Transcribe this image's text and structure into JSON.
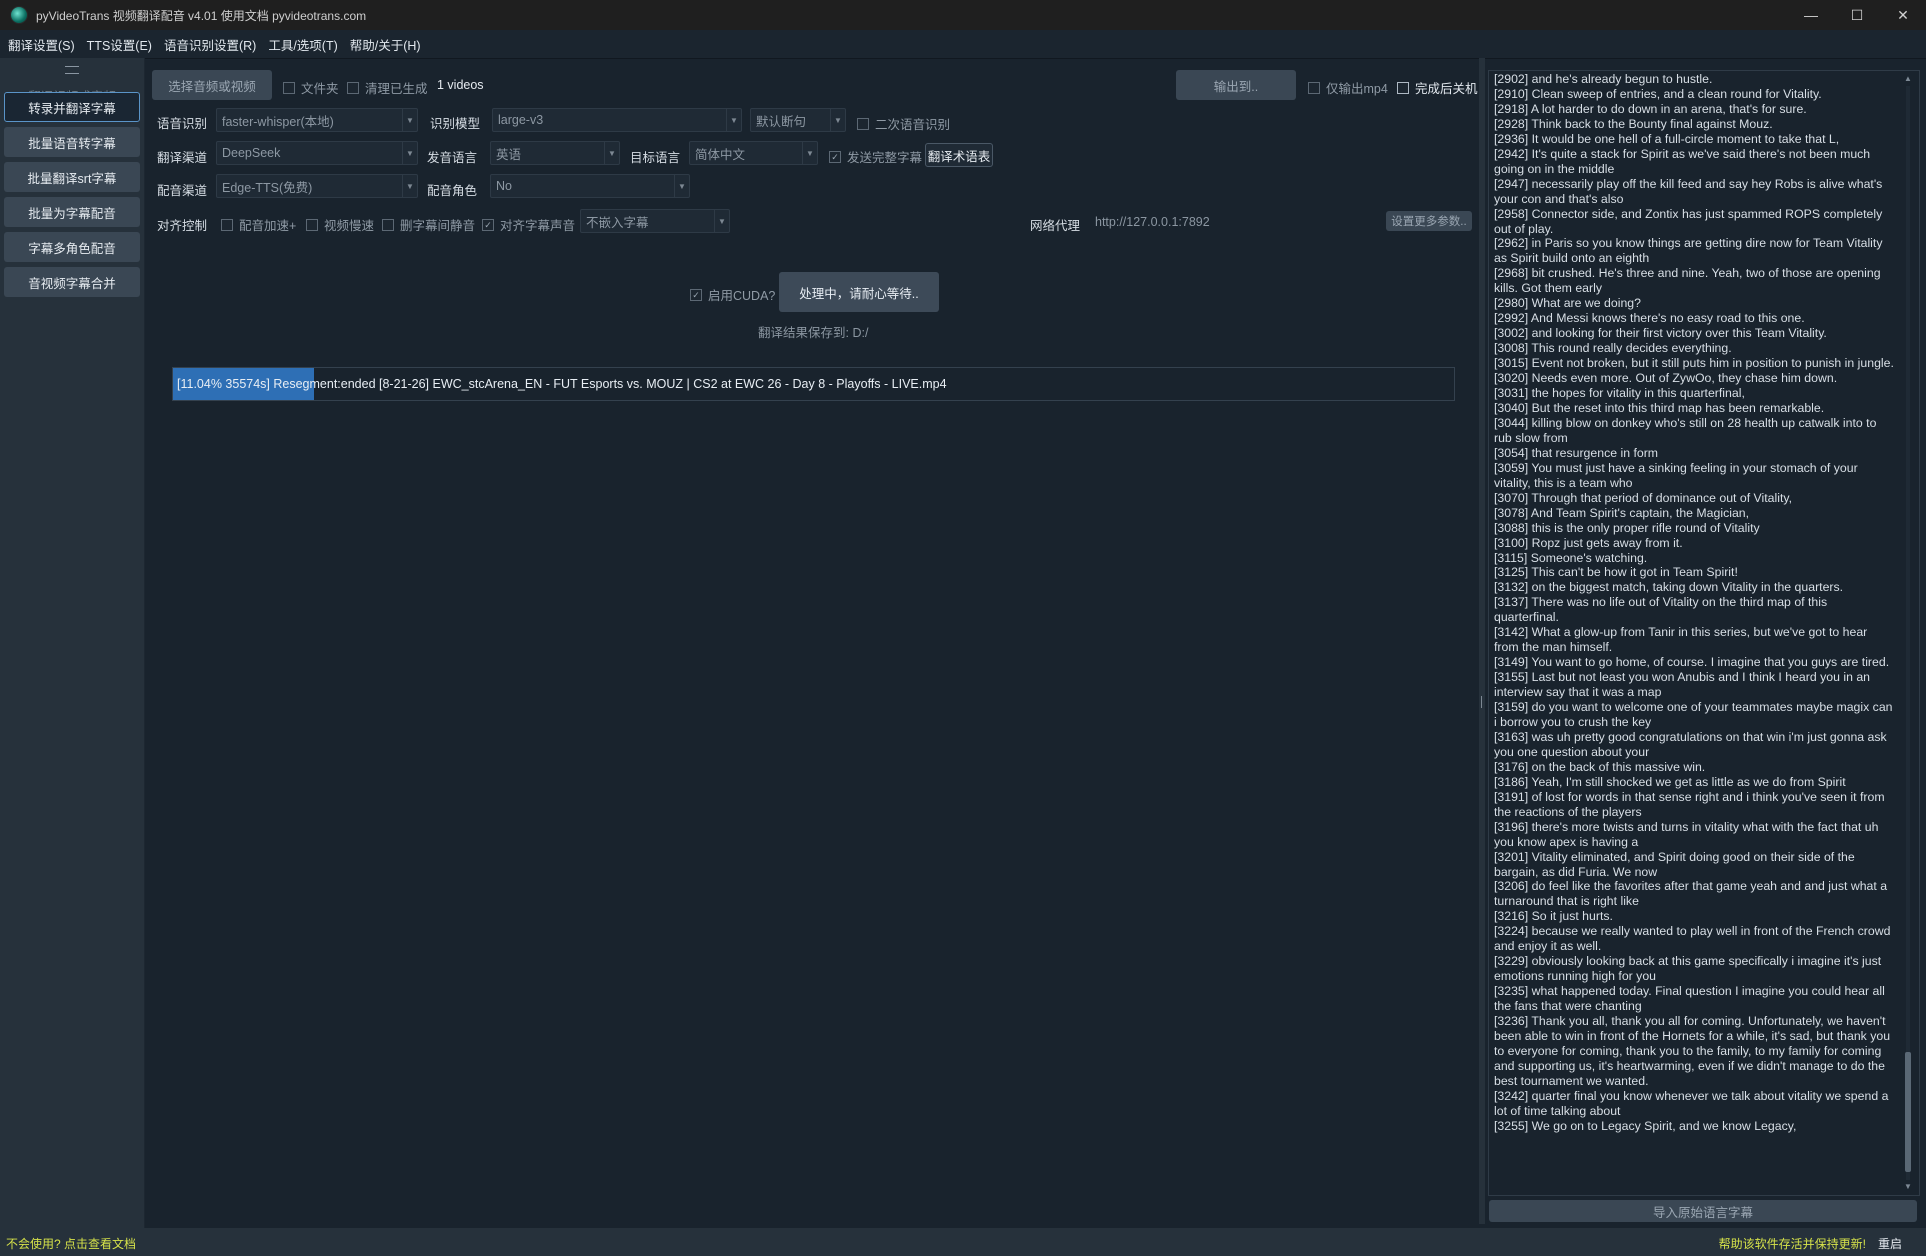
{
  "window": {
    "title": "pyVideoTrans 视频翻译配音 v4.01 使用文档 pyvideotrans.com",
    "minimize": "—",
    "maximize": "☐",
    "close": "✕"
  },
  "menu": [
    "翻译设置(S)",
    "TTS设置(E)",
    "语音识别设置(R)",
    "工具/选项(T)",
    "帮助/关于(H)"
  ],
  "sidebar": {
    "header": "翻译视频或音频",
    "items": [
      "转录并翻译字幕",
      "批量语音转字幕",
      "批量翻译srt字幕",
      "批量为字幕配音",
      "字幕多角色配音",
      "音视频字幕合并"
    ]
  },
  "top_row": {
    "select_button": "选择音频或视频",
    "folder_label": "文件夹",
    "clean_label": "清理已生成",
    "video_count": "1 videos",
    "output_button": "输出到..",
    "only_mp4_label": "仅输出mp4",
    "shutdown_label": "完成后关机"
  },
  "asr_row": {
    "asr_label": "语音识别",
    "asr_value": "faster-whisper(本地)",
    "model_label": "识别模型",
    "model_value": "large-v3",
    "split_value": "默认断句",
    "second_asr_label": "二次语音识别"
  },
  "translate_row": {
    "channel_label": "翻译渠道",
    "channel_value": "DeepSeek",
    "source_label": "发音语言",
    "source_value": "英语",
    "target_label": "目标语言",
    "target_value": "简体中文",
    "send_full_label": "发送完整字幕",
    "glossary_button": "翻译术语表"
  },
  "dub_row": {
    "channel_label": "配音渠道",
    "channel_value": "Edge-TTS(免费)",
    "role_label": "配音角色",
    "role_value": "No"
  },
  "align_row": {
    "label": "对齐控制",
    "speedup_label": "配音加速+",
    "slowdown_label": "视频慢速",
    "remove_silence_label": "删字幕间静音",
    "align_sound_label": "对齐字幕声音",
    "embed_value": "不嵌入字幕",
    "proxy_label": "网络代理",
    "proxy_value": "http://127.0.0.1:7892",
    "more_button": "设置更多参数.."
  },
  "action": {
    "cuda_label": "启用CUDA?",
    "processing_button": "处理中，请耐心等待..",
    "save_path": "翻译结果保存到: D:/"
  },
  "progress": {
    "percent": 11.04,
    "text": "[11.04%  35574s]  Resegment:ended [8-21-26] EWC_stcArena_EN - FUT Esports vs. MOUZ  |  CS2 at EWC 26 - Day 8 - Playoffs - LIVE.mp4"
  },
  "log_lines": [
    "[2902]  and he's already begun to hustle.",
    "[2910]  Clean sweep of entries, and a clean round for Vitality.",
    "[2918]  A lot harder to do down in an arena, that's for sure.",
    "[2928]  Think back to the Bounty final against Mouz.",
    "[2936]  It would be one hell of a full-circle moment to take that L,",
    "[2942]  It's quite a stack for Spirit as we've said there's not been much going on in the middle",
    "[2947]  necessarily play off the kill feed and say hey Robs is alive what's your con and that's also",
    "[2958]  Connector side, and Zontix has just spammed ROPS completely out of play.",
    "[2962]  in Paris so you know things are getting dire now for Team Vitality as Spirit build onto an eighth",
    "[2968]  bit crushed. He's three and nine. Yeah, two of those are opening kills. Got them early",
    "[2980]  What are we doing?",
    "[2992]  And Messi knows there's no easy road to this one.",
    "[3002]  and looking for their first victory over this Team Vitality.",
    "[3008]  This round really decides everything.",
    "[3015]  Event not broken, but it still puts him in position to punish in jungle.",
    "[3020]  Needs even more. Out of ZywOo, they chase him down.",
    "[3031]  the hopes for vitality in this quarterfinal,",
    "[3040]  But the reset into this third map has been remarkable.",
    "[3044]  killing blow on donkey who's still on 28 health up catwalk into to rub slow from",
    "[3054]  that resurgence in form",
    "[3059]  You must just have a sinking feeling in your stomach of your vitality, this is a team who",
    "[3070]  Through that period of dominance out of Vitality,",
    "[3078]  And Team Spirit's captain, the Magician,",
    "[3088]  this is the only proper rifle round of Vitality",
    "[3100]  Ropz just gets away from it.",
    "[3115]  Someone's watching.",
    "[3125]  This can't be how it got in Team Spirit!",
    "[3132]  on the biggest match, taking down Vitality in the quarters.",
    "[3137]  There was no life out of Vitality on the third map of this quarterfinal.",
    "[3142]  What a glow-up from Tanir in this series, but we've got to hear from the man himself.",
    "[3149]  You want to go home, of course. I imagine that you guys are tired.",
    "[3155]  Last but not least you won Anubis and I think I heard you in an interview say that it was a map",
    "[3159]  do you want to welcome one of your teammates maybe magix can i borrow you to crush the key",
    "[3163]  was uh pretty good congratulations on that win i'm just gonna ask you one question about your",
    "[3176]  on the back of this massive win.",
    "[3186]  Yeah, I'm still shocked we get as little as we do from Spirit",
    "[3191]  of lost for words in that sense right and i think you've seen it from the reactions of the players",
    "[3196]  there's more twists and turns in vitality what with the fact that uh you know apex is having a",
    "[3201]  Vitality eliminated, and Spirit doing good on their side of the bargain, as did Furia. We now",
    "[3206]  do feel like the favorites after that game yeah and and just what a turnaround that is right like",
    "[3216]  So it just hurts.",
    "[3224]  because we really wanted to play well in front of the French crowd and enjoy it as well.",
    "[3229]  obviously looking back at this game specifically i imagine it's just emotions running high for you",
    "[3235]  what happened today. Final question I imagine you could hear all the fans that were chanting",
    "[3236]  Thank you all, thank you all for coming. Unfortunately, we haven't been able to win in front of the Hornets for a while, it's sad, but thank you to everyone for coming, thank you to the family, to my family for coming and supporting us, it's heartwarming, even if we didn't manage to do the best tournament we wanted.",
    "[3242]  quarter final you know whenever we talk about vitality we spend a lot of time talking about",
    "[3255]  We go on to Legacy Spirit, and we know Legacy,"
  ],
  "import_button": "导入原始语言字幕",
  "status": {
    "help_link": "不会使用? 点击查看文档",
    "support_link": "帮助该软件存活并保持更新!",
    "restart": "重启"
  }
}
